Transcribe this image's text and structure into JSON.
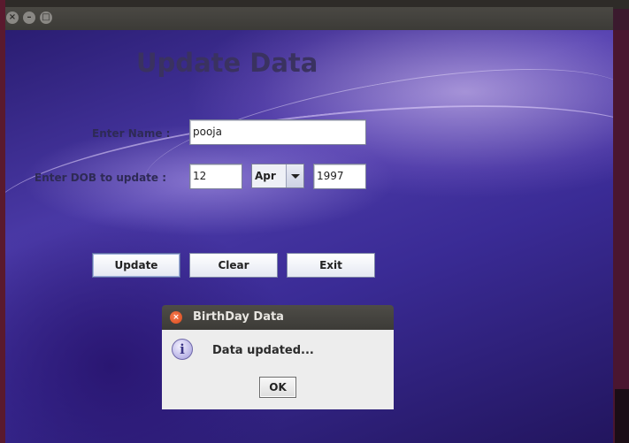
{
  "window": {
    "close_glyph": "×",
    "minimize_glyph": "–",
    "maximize_glyph": "□"
  },
  "form": {
    "heading": "Update Data",
    "name_label": "Enter Name :",
    "name_value": "pooja",
    "dob_label": "Enter DOB to update :",
    "day_value": "12",
    "month_value": "Apr",
    "year_value": "1997"
  },
  "buttons": {
    "update": "Update",
    "clear": "Clear",
    "exit": "Exit"
  },
  "dialog": {
    "title": "BirthDay Data",
    "close_glyph": "×",
    "icon_glyph": "i",
    "message": "Data updated...",
    "ok": "OK"
  },
  "icons": {
    "window_controls": [
      "close-icon",
      "minimize-icon",
      "maximize-icon"
    ],
    "dialog": [
      "info-icon",
      "close-icon"
    ],
    "combo": "chevron-down-icon"
  },
  "colors": {
    "heading": "#3a3260",
    "label": "#2e2a55",
    "dialog_close": "#e0552a"
  }
}
